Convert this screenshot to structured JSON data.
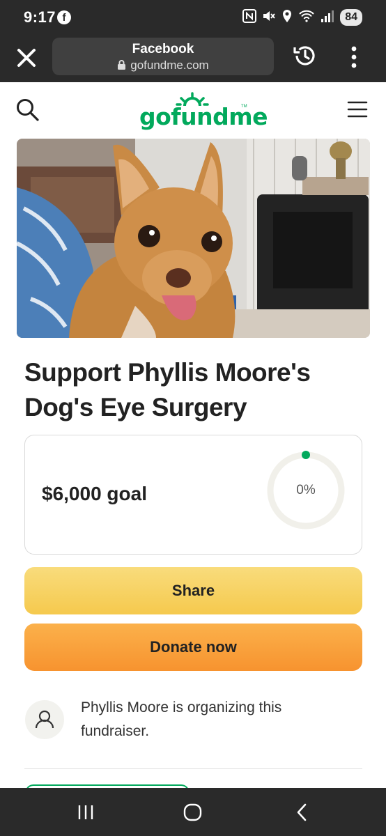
{
  "status_bar": {
    "time": "9:17",
    "battery": "84",
    "app_icon": "facebook-icon",
    "icons": [
      "nfc-icon",
      "mute-icon",
      "location-icon",
      "wifi-icon",
      "signal-icon"
    ]
  },
  "browser": {
    "title": "Facebook",
    "domain": "gofundme.com",
    "icons": [
      "close-icon",
      "lock-icon",
      "history-icon",
      "more-vertical-icon"
    ]
  },
  "site_header": {
    "logo_text": "gofundme",
    "trademark": "TM",
    "icons": [
      "search-icon",
      "hamburger-menu-icon"
    ],
    "brand_color": "#02a95c"
  },
  "campaign": {
    "title": "Support Phyllis Moore's Dog's Eye Surgery",
    "goal_label": "$6,000 goal",
    "progress_label": "0%",
    "progress_fraction": 0
  },
  "actions": {
    "share_label": "Share",
    "donate_label": "Donate now",
    "share_color": "#f5c94d",
    "donate_color": "#f7932f"
  },
  "organizer": {
    "text": "Phyllis Moore is organizing this fundraiser.",
    "icon": "person-icon"
  },
  "nav_bar": {
    "icons": [
      "recents-icon",
      "home-icon",
      "back-icon"
    ]
  }
}
